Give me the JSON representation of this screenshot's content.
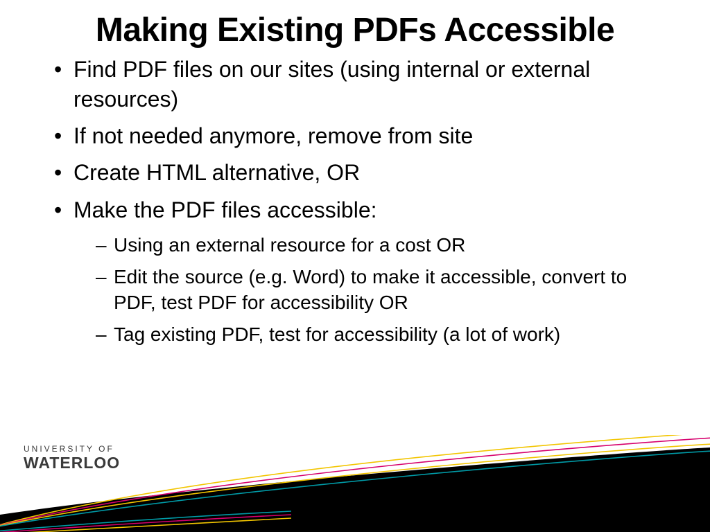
{
  "title": "Making Existing PDFs Accessible",
  "bullets": [
    {
      "text": "Find PDF files on our sites (using internal or external resources)"
    },
    {
      "text": "If not needed anymore, remove from site"
    },
    {
      "text": "Create HTML alternative, OR"
    },
    {
      "text": "Make the PDF files accessible:",
      "sub": [
        "Using an external resource for a cost OR",
        "Edit the source (e.g. Word) to make it accessible, convert to PDF, test PDF for accessibility OR",
        "Tag existing PDF, test for accessibility (a lot of work)"
      ]
    }
  ],
  "logo": {
    "line1": "UNIVERSITY OF",
    "line2": "WATERLOO"
  },
  "swoosh_colors": {
    "yellow": "#f2c500",
    "magenta": "#d6006d",
    "teal": "#009aa6",
    "black": "#000000"
  }
}
